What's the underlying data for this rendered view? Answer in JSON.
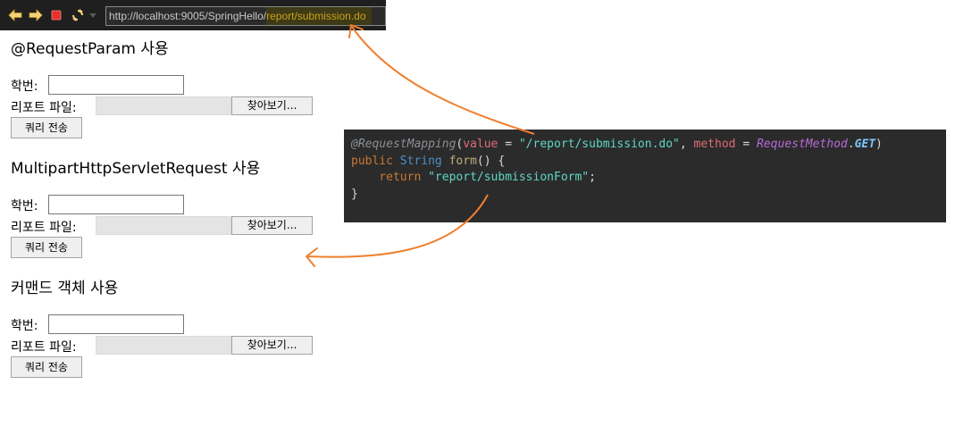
{
  "browser": {
    "url_base": "http://localhost:9005/SpringHello/",
    "url_path": "report/submission.do",
    "icons": [
      "back-icon",
      "forward-icon",
      "stop-icon",
      "refresh-icon",
      "dropdown-icon"
    ]
  },
  "forms": [
    {
      "title": "@RequestParam 사용",
      "student_id_label": "학번:",
      "student_id_value": "",
      "report_file_label": "리포트 파일:",
      "browse_label": "찾아보기...",
      "submit_label": "쿼리 전송"
    },
    {
      "title": "MultipartHttpServletRequest 사용",
      "student_id_label": "학번:",
      "student_id_value": "",
      "report_file_label": "리포트 파일:",
      "browse_label": "찾아보기...",
      "submit_label": "쿼리 전송"
    },
    {
      "title": "커맨드 객체 사용",
      "student_id_label": "학번:",
      "student_id_value": "",
      "report_file_label": "리포트 파일:",
      "browse_label": "찾아보기...",
      "submit_label": "쿼리 전송"
    }
  ],
  "code": {
    "line1": {
      "annotation": "@RequestMapping",
      "open": "(",
      "param1": "value",
      "eq1": " = ",
      "value1": "\"/report/submission.do\"",
      "comma": ", ",
      "param2": "method",
      "eq2": " = ",
      "enum_type": "RequestMethod",
      "dot": ".",
      "enum_const": "GET",
      "close": ")"
    },
    "line2": {
      "kw_public": "public",
      "type": "String",
      "method": "form",
      "rest": "() {"
    },
    "line3": {
      "kw_return": "return",
      "value": "\"report/submissionForm\"",
      "semi": ";"
    },
    "line4": {
      "close": "}"
    }
  },
  "colors": {
    "arrow": "#f07f2e",
    "code_background": "#2b2b2b",
    "url_highlight": "#c9a21a"
  }
}
